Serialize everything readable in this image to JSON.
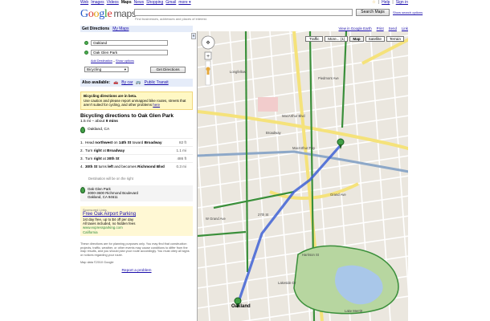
{
  "topnav": {
    "web": "Web",
    "images": "Images",
    "videos": "Videos",
    "maps": "Maps",
    "news": "News",
    "shopping": "Shopping",
    "gmail": "Gmail",
    "more": "more ▾",
    "star": "☆",
    "help": "Help",
    "signin": "Sign in"
  },
  "header": {
    "search_placeholder": "",
    "search_button": "Search Maps",
    "show_options": "Show search options",
    "hint": "Find businesses, addresses and places of interest."
  },
  "panel": {
    "tab_directions": "Get Directions",
    "tab_mymaps": "My Maps",
    "from": "Oakland",
    "to": "Oak Glen Park",
    "add_destination": "Add Destination",
    "show_options": "Show options",
    "mode": "Bicycling",
    "get_directions": "Get Directions",
    "also_label": "Also available:",
    "by_car": "By car",
    "public_transit": "Public Transit",
    "beta_title": "Bicycling directions are in beta.",
    "beta_text": "Use caution and please report unmapped bike routes, streets that aren't suited for cycling, and other problems",
    "beta_link": "here",
    "dir_title": "Bicycling directions to Oak Glen Park",
    "distance": "1.5 mi – about",
    "duration": "9 mins",
    "start": "Oakland, CA",
    "steps": [
      {
        "n": "1.",
        "pre": "Head ",
        "b1": "northwest",
        "mid": " on ",
        "b2": "14th St",
        "post": " toward ",
        "b3": "Broadway",
        "d": "82 ft"
      },
      {
        "n": "2.",
        "pre": "Turn ",
        "b1": "right",
        "mid": " at ",
        "b2": "Broadway",
        "post": "",
        "b3": "",
        "d": "1.1 mi"
      },
      {
        "n": "3.",
        "pre": "Turn ",
        "b1": "right",
        "mid": " at ",
        "b2": "30th St",
        "post": "",
        "b3": "",
        "d": "486 ft"
      },
      {
        "n": "4.",
        "pre": "",
        "b1": "30th St",
        "mid": " turns ",
        "b2": "left",
        "post": " and becomes ",
        "b3": "Richmond Blvd",
        "d": "0.3 mi"
      }
    ],
    "dest_note": "Destination will be on the right",
    "dest_name": "Oak Glen Park",
    "dest_addr1": "3000-3600 Richmond Boulevard",
    "dest_addr2": "Oakland, CA 94611",
    "ads_label": "Sponsored Links",
    "ad_title": "Free Oak Airport Parking",
    "ad_line1": "1st day free, up to $4 off per day",
    "ad_line2": "All taxes included, no hidden fees",
    "ad_url": "www.expressparking.com",
    "ad_region": "California",
    "disclaimer": "These directions are for planning purposes only. You may find that construction projects, traffic, weather, or other events may cause conditions to differ from the map results, and you should plan your route accordingly. You must obey all signs or notices regarding your route.",
    "map_data": "Map data ©2010 Google",
    "report": "Report a problem"
  },
  "map": {
    "earth": "View in Google Earth",
    "print": "Print",
    "send": "Send",
    "link": "Link",
    "traffic": "Traffic",
    "more": "More... (1)",
    "map_btn": "Map",
    "satellite": "Satellite",
    "terrain": "Terrain",
    "labels": {
      "l1": "Longfellow",
      "l2": "MacArthur Blvd",
      "l3": "MacArthur Fwy",
      "l4": "Broadway",
      "l5": "Grand Ave",
      "l6": "Lake Merritt",
      "l7": "Oakland",
      "l8": "Piedmont Ave",
      "l9": "W Grand Ave",
      "l10": "27th St",
      "l11": "Harrison St",
      "l12": "Lakeside Dr"
    },
    "colors": {
      "road": "#ffffff",
      "major": "#f5e27a",
      "park": "#b7d6a0",
      "water": "#a9c7e9",
      "route": "#3f62d6",
      "bikepath": "#3a8f3a"
    }
  }
}
